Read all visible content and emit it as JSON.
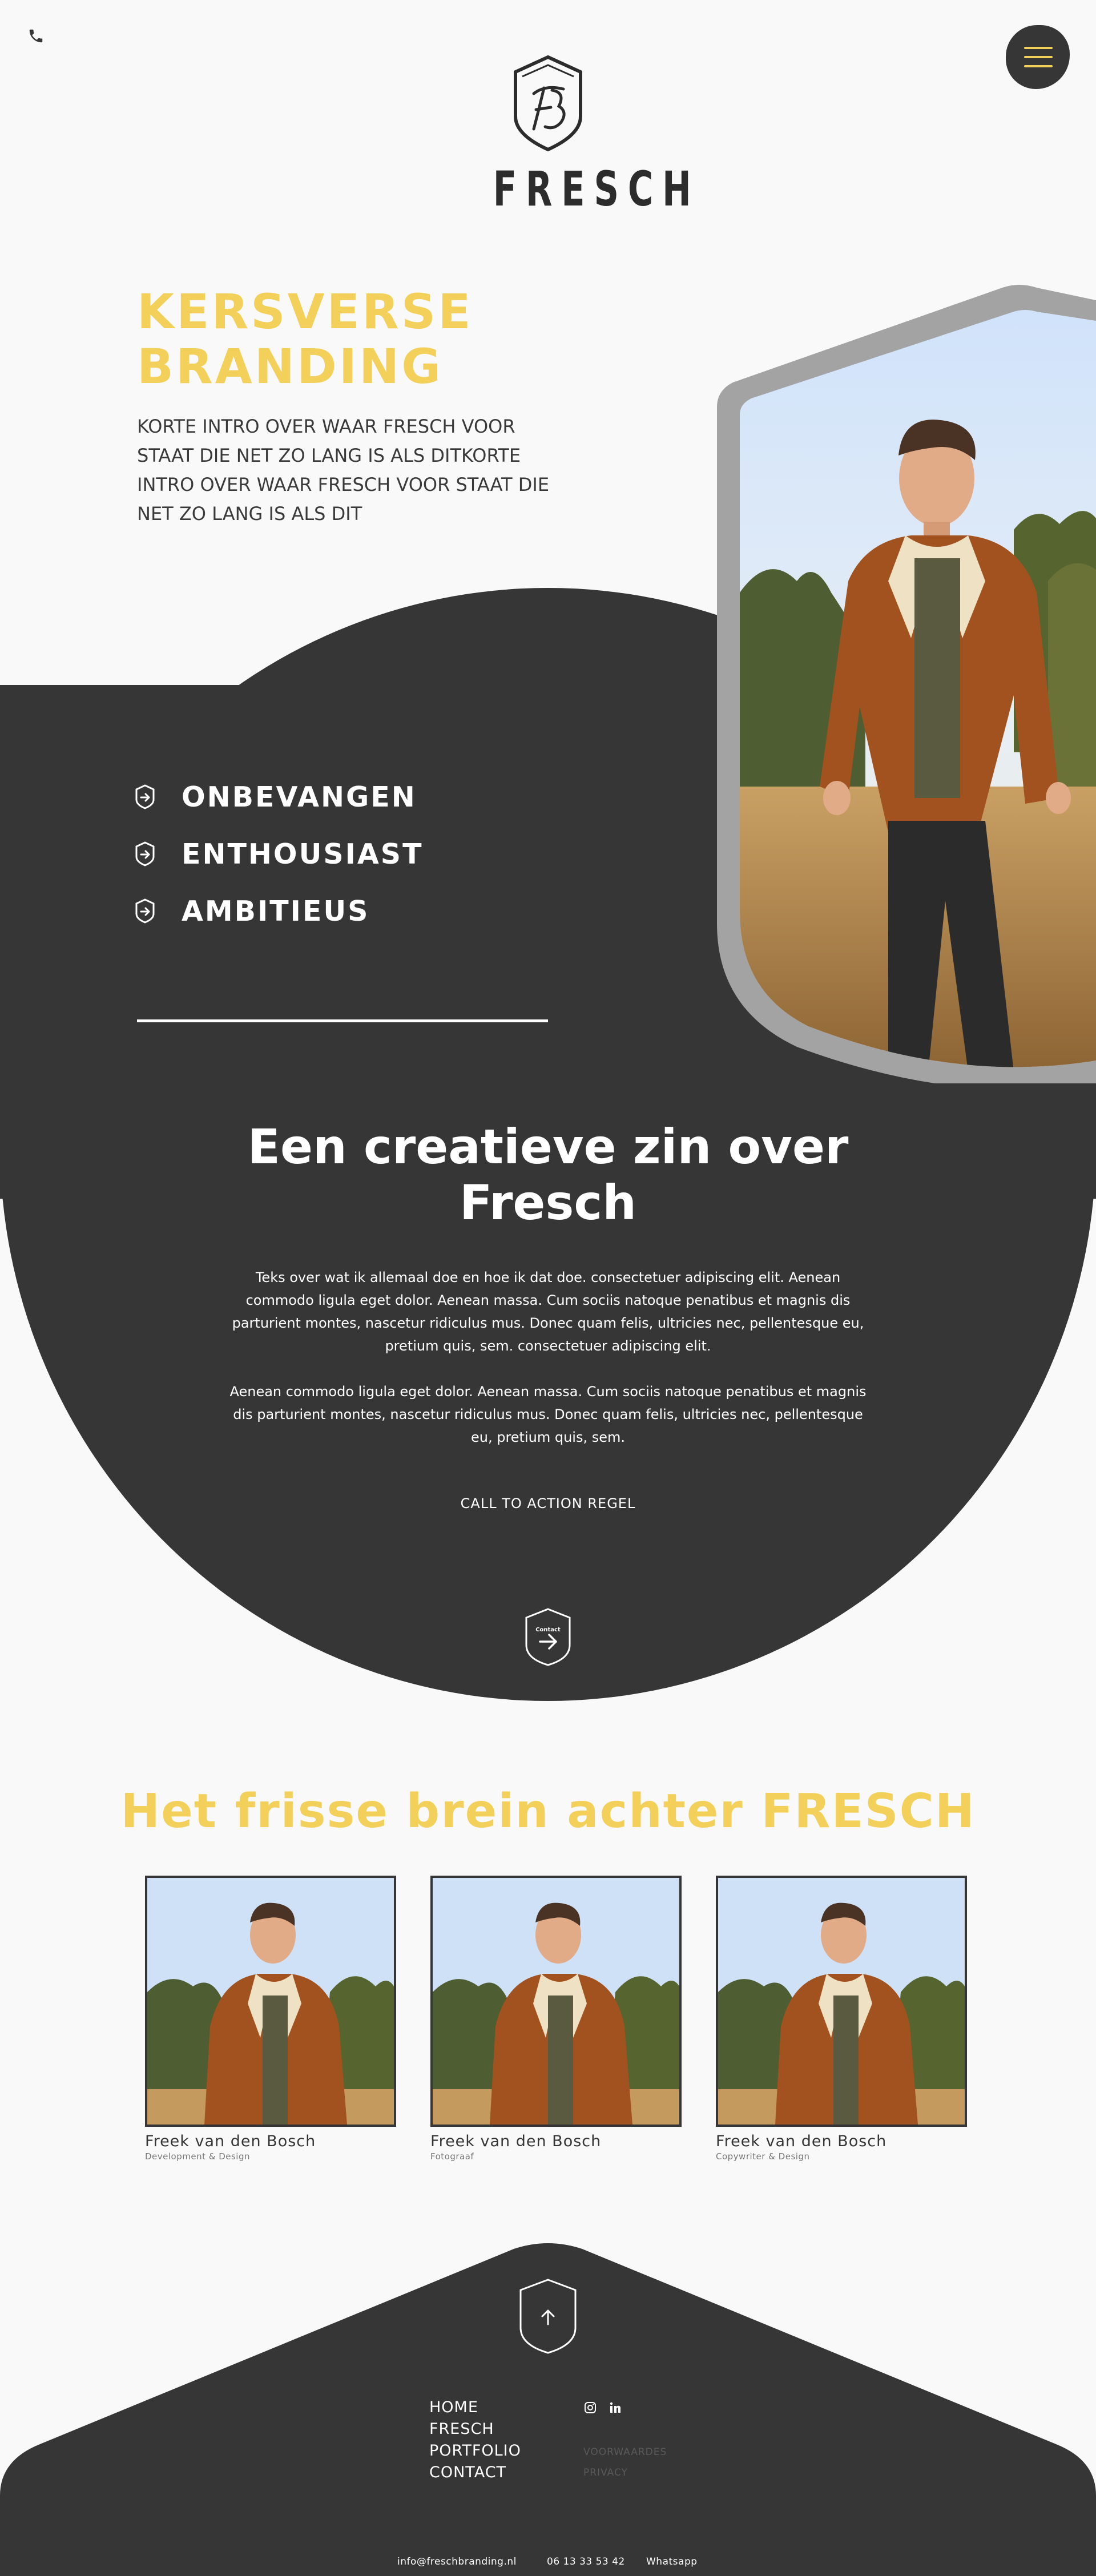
{
  "header": {
    "logo_text": "FRESCH",
    "phone_icon": "phone-icon",
    "menu_icon": "hamburger-menu-icon"
  },
  "hero": {
    "title_line1": "KERSVERSE",
    "title_line2": "BRANDING",
    "intro": "KORTE INTRO OVER WAAR FRESCH VOOR STAAT DIE NET ZO LANG IS ALS DITKORTE INTRO OVER WAAR FRESCH VOOR STAAT DIE NET ZO LANG IS ALS DIT"
  },
  "values": {
    "items": [
      {
        "label": "ONBEVANGEN",
        "icon": "shield-arrow-icon"
      },
      {
        "label": "ENTHOUSIAST",
        "icon": "shield-arrow-icon"
      },
      {
        "label": "AMBITIEUS",
        "icon": "shield-arrow-icon"
      }
    ]
  },
  "creative": {
    "title_line1": "Een creatieve zin over",
    "title_line2": "Fresch",
    "paragraph1": "Teks over wat ik allemaal doe en hoe ik dat doe. consectetuer adipiscing elit. Aenean commodo ligula eget dolor. Aenean massa. Cum sociis natoque penatibus et magnis dis parturient montes, nascetur ridiculus mus. Donec quam felis, ultricies nec, pellentesque eu, pretium quis, sem. consectetuer adipiscing elit.",
    "paragraph2": "Aenean commodo ligula eget dolor. Aenean massa. Cum sociis natoque penatibus et magnis dis parturient montes, nascetur ridiculus mus. Donec quam felis, ultricies nec, pellentesque eu, pretium quis, sem.",
    "cta": "CALL TO ACTION REGEL",
    "contact_label": "Contact"
  },
  "team": {
    "title": "Het frisse brein achter FRESCH",
    "members": [
      {
        "name": "Freek van den Bosch",
        "role": "Development & Design"
      },
      {
        "name": "Freek van den Bosch",
        "role": "Fotograaf"
      },
      {
        "name": "Freek van den Bosch",
        "role": "Copywriter & Design"
      }
    ]
  },
  "footer": {
    "nav": [
      "HOME",
      "FRESCH",
      "PORTFOLIO",
      "CONTACT"
    ],
    "social_icons": [
      "instagram-icon",
      "linkedin-icon"
    ],
    "legal": [
      "VOORWAARDES",
      "PRIVACY"
    ],
    "email": "info@freschbranding.nl",
    "phone": "06 13 33 53 42",
    "whatsapp": "Whatsapp"
  },
  "colors": {
    "accent": "#f2d05a",
    "dark": "#363636",
    "background": "#f9f9f9",
    "frame_grey": "#a3a3a3"
  }
}
